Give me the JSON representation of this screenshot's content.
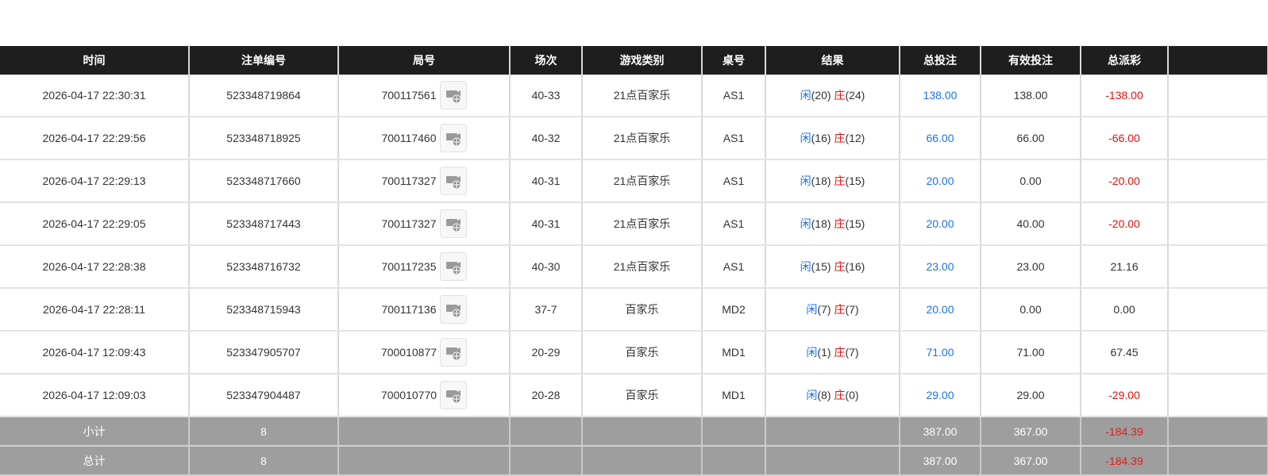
{
  "header": [
    "时间",
    "注单编号",
    "局号",
    "场次",
    "游戏类别",
    "桌号",
    "结果",
    "总投注",
    "有效投注",
    "总派彩",
    ""
  ],
  "colors": {
    "blue": "#1a73e8",
    "red": "#e01010",
    "header_bg": "#1e1e1e",
    "summary_bg": "#9e9e9e"
  },
  "replay_icon": "film-reel-icon",
  "labels": {
    "player": "闲",
    "banker": "庄"
  },
  "rows": [
    {
      "time": "2026-04-17 22:30:31",
      "bet_id": "523348719864",
      "round": "700117561",
      "session": "40-33",
      "game": "21点百家乐",
      "table": "AS1",
      "player_score": "(20)",
      "banker_score": "(24)",
      "total_bet": "138.00",
      "valid_bet": "138.00",
      "payout": "-138.00",
      "payout_negative": true
    },
    {
      "time": "2026-04-17 22:29:56",
      "bet_id": "523348718925",
      "round": "700117460",
      "session": "40-32",
      "game": "21点百家乐",
      "table": "AS1",
      "player_score": "(16)",
      "banker_score": "(12)",
      "total_bet": "66.00",
      "valid_bet": "66.00",
      "payout": "-66.00",
      "payout_negative": true
    },
    {
      "time": "2026-04-17 22:29:13",
      "bet_id": "523348717660",
      "round": "700117327",
      "session": "40-31",
      "game": "21点百家乐",
      "table": "AS1",
      "player_score": "(18)",
      "banker_score": "(15)",
      "total_bet": "20.00",
      "valid_bet": "0.00",
      "payout": "-20.00",
      "payout_negative": true
    },
    {
      "time": "2026-04-17 22:29:05",
      "bet_id": "523348717443",
      "round": "700117327",
      "session": "40-31",
      "game": "21点百家乐",
      "table": "AS1",
      "player_score": "(18)",
      "banker_score": "(15)",
      "total_bet": "20.00",
      "valid_bet": "40.00",
      "payout": "-20.00",
      "payout_negative": true
    },
    {
      "time": "2026-04-17 22:28:38",
      "bet_id": "523348716732",
      "round": "700117235",
      "session": "40-30",
      "game": "21点百家乐",
      "table": "AS1",
      "player_score": "(15)",
      "banker_score": "(16)",
      "total_bet": "23.00",
      "valid_bet": "23.00",
      "payout": "21.16",
      "payout_negative": false
    },
    {
      "time": "2026-04-17 22:28:11",
      "bet_id": "523348715943",
      "round": "700117136",
      "session": "37-7",
      "game": "百家乐",
      "table": "MD2",
      "player_score": "(7)",
      "banker_score": "(7)",
      "total_bet": "20.00",
      "valid_bet": "0.00",
      "payout": "0.00",
      "payout_negative": false
    },
    {
      "time": "2026-04-17 12:09:43",
      "bet_id": "523347905707",
      "round": "700010877",
      "session": "20-29",
      "game": "百家乐",
      "table": "MD1",
      "player_score": "(1)",
      "banker_score": "(7)",
      "total_bet": "71.00",
      "valid_bet": "71.00",
      "payout": "67.45",
      "payout_negative": false
    },
    {
      "time": "2026-04-17 12:09:03",
      "bet_id": "523347904487",
      "round": "700010770",
      "session": "20-28",
      "game": "百家乐",
      "table": "MD1",
      "player_score": "(8)",
      "banker_score": "(0)",
      "total_bet": "29.00",
      "valid_bet": "29.00",
      "payout": "-29.00",
      "payout_negative": true
    }
  ],
  "subtotal": {
    "label": "小计",
    "count": "8",
    "total_bet": "387.00",
    "valid_bet": "367.00",
    "payout": "-184.39"
  },
  "total": {
    "label": "总计",
    "count": "8",
    "total_bet": "387.00",
    "valid_bet": "367.00",
    "payout": "-184.39"
  }
}
